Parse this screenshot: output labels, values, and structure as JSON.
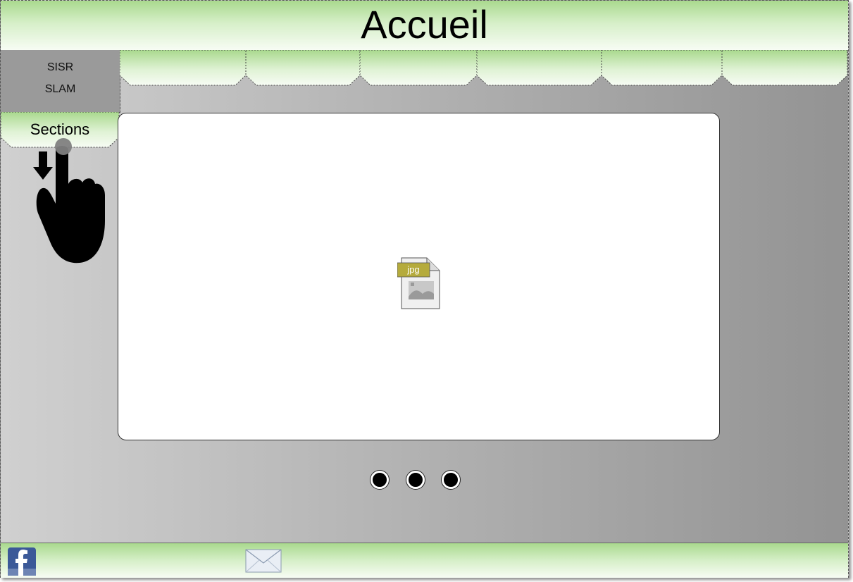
{
  "header": {
    "title": "Accueil"
  },
  "sidebar": {
    "items": [
      {
        "label": "SISR"
      },
      {
        "label": "SLAM"
      }
    ]
  },
  "sections_tab": {
    "label": "Sections"
  },
  "tabs": [
    {
      "label": ""
    },
    {
      "label": ""
    },
    {
      "label": ""
    },
    {
      "label": ""
    },
    {
      "label": ""
    },
    {
      "label": ""
    }
  ],
  "main": {
    "image_placeholder": {
      "icon": "jpg-file-icon",
      "badge": "jpg"
    }
  },
  "carousel": {
    "dots": 3
  },
  "footer": {
    "icons": [
      "facebook-icon",
      "mail-icon"
    ]
  },
  "colors": {
    "header_green": "#a9d98e",
    "panel_gray": "#9a9a9a",
    "badge_olive": "#b5ab3c"
  },
  "gesture": {
    "icon": "swipe-down-hand-icon"
  }
}
